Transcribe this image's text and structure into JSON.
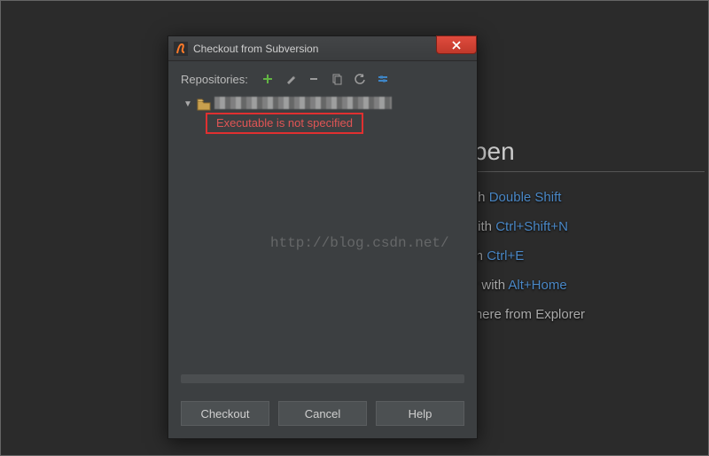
{
  "background": {
    "heading_fragment": "e open",
    "lines": [
      {
        "prefix": "ere with  ",
        "kbd": "Double Shift"
      },
      {
        "prefix": "ame with  ",
        "kbd": "Ctrl+Shift+N"
      },
      {
        "prefix": "les with  ",
        "kbd": "Ctrl+E"
      },
      {
        "prefix": "on Bar with  ",
        "kbd": "Alt+Home"
      },
      {
        "prefix": "file(s) here from Explorer",
        "kbd": ""
      }
    ]
  },
  "dialog": {
    "title": "Checkout from Subversion",
    "repositories_label": "Repositories:",
    "error_message": "Executable is not specified",
    "buttons": {
      "checkout": "Checkout",
      "cancel": "Cancel",
      "help": "Help"
    }
  },
  "watermark": "http://blog.csdn.net/"
}
